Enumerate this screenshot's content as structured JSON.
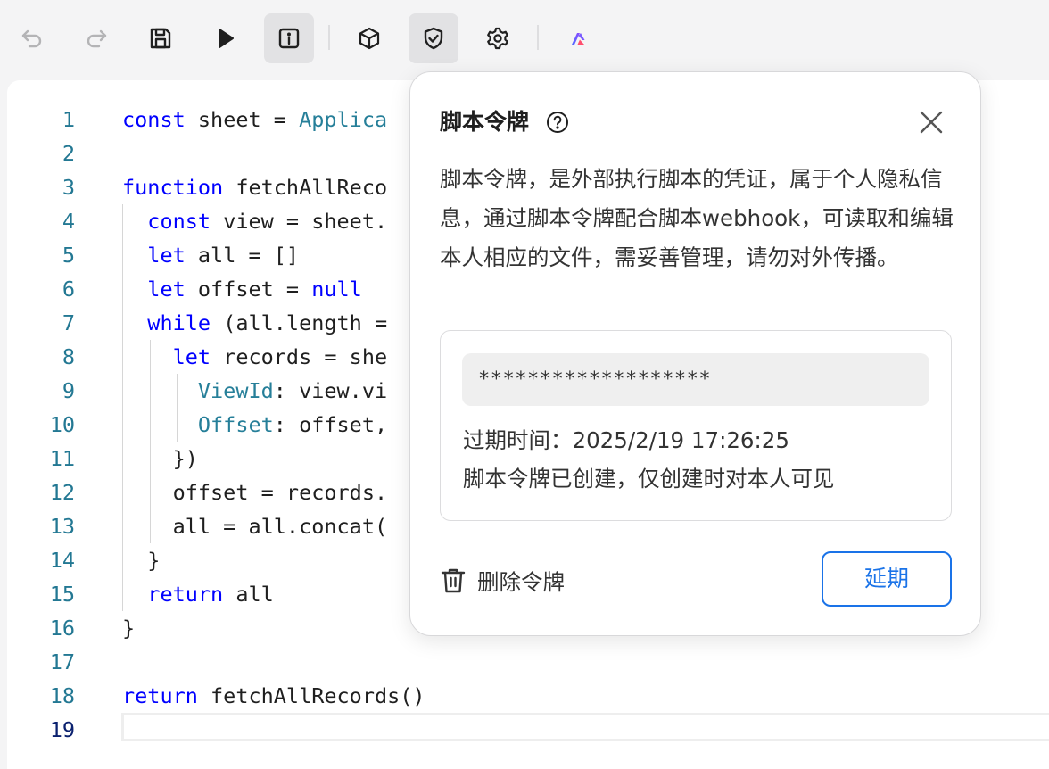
{
  "toolbar": {
    "buttons": [
      {
        "icon": "undo-icon"
      },
      {
        "icon": "redo-icon"
      },
      {
        "icon": "save-icon"
      },
      {
        "icon": "run-icon"
      },
      {
        "icon": "info-icon",
        "active": true
      },
      {
        "icon": "cube-icon"
      },
      {
        "icon": "shield-check-icon",
        "active": true
      },
      {
        "icon": "gear-icon"
      },
      {
        "icon": "brand-logo-icon"
      }
    ]
  },
  "editor": {
    "current_line": 19,
    "lines": [
      {
        "n": "1",
        "text": "const sheet = Applica"
      },
      {
        "n": "2",
        "text": ""
      },
      {
        "n": "3",
        "text": "function fetchAllReco"
      },
      {
        "n": "4",
        "text": "  const view = sheet."
      },
      {
        "n": "5",
        "text": "  let all = []"
      },
      {
        "n": "6",
        "text": "  let offset = null"
      },
      {
        "n": "7",
        "text": "  while (all.length ="
      },
      {
        "n": "8",
        "text": "    let records = she"
      },
      {
        "n": "9",
        "text": "      ViewId: view.vi"
      },
      {
        "n": "10",
        "text": "      Offset: offset,"
      },
      {
        "n": "11",
        "text": "    })"
      },
      {
        "n": "12",
        "text": "    offset = records."
      },
      {
        "n": "13",
        "text": "    all = all.concat("
      },
      {
        "n": "14",
        "text": "  }"
      },
      {
        "n": "15",
        "text": "  return all"
      },
      {
        "n": "16",
        "text": "}"
      },
      {
        "n": "17",
        "text": ""
      },
      {
        "n": "18",
        "text": "return fetchAllRecords()"
      },
      {
        "n": "19",
        "text": ""
      }
    ]
  },
  "popup": {
    "title": "脚本令牌",
    "description": "脚本令牌，是外部执行脚本的凭证，属于个人隐私信息，通过脚本令牌配合脚本webhook，可读取和编辑本人相应的文件，需妥善管理，请勿对外传播。",
    "token_masked": "*******************",
    "expiry": "过期时间：2025/2/19 17:26:25",
    "created_note": "脚本令牌已创建，仅创建时对本人可见",
    "delete_label": "删除令牌",
    "extend_label": "延期"
  },
  "colors": {
    "accent": "#1a73e8",
    "keyword": "#0000ff",
    "type": "#267f99",
    "line_number": "#237893"
  }
}
